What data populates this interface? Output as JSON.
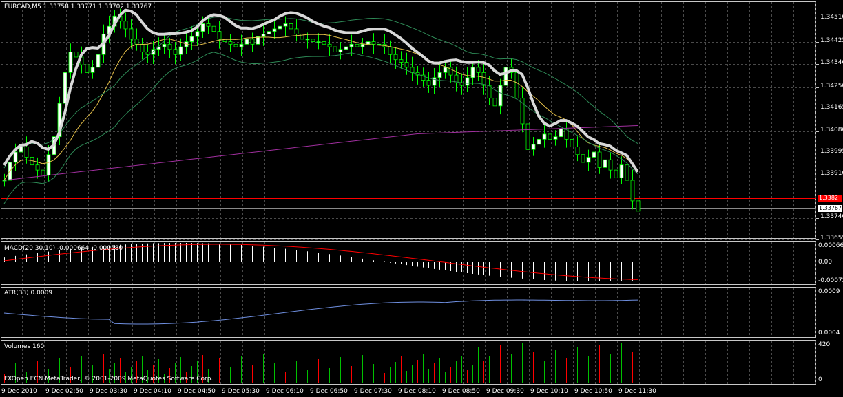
{
  "main": {
    "title": "EURCAD,M5  1.33758 1.33771 1.33702 1.33767",
    "price_levels": [
      "1.34510",
      "1.34425",
      "1.34340",
      "1.34250",
      "1.34165",
      "1.34080",
      "1.33995",
      "1.33910",
      "1.33825",
      "1.33740",
      "1.33655"
    ],
    "current_price": "1.33767",
    "line_price": "1.3382",
    "colors": {
      "background": "#000000",
      "grid": "#4a4a4a",
      "up_candle": "#ffffff",
      "down_candle": "#000000",
      "outline": "#00ff00",
      "ma_fast": "#e8c24a",
      "ma_slow": "#a02f9e",
      "bands": "#2e8b57",
      "envelope": "#d8d8d8",
      "hline": "#ff0000"
    }
  },
  "macd": {
    "title": "MACD(20,30,10) -0.000664 -0.000580",
    "levels": [
      "0.00066",
      "0.00",
      "-0.00072"
    ]
  },
  "atr": {
    "title": "ATR(33) 0.0009",
    "levels": [
      "0.0009",
      "0.0004"
    ]
  },
  "volumes": {
    "title": "Volumes 160",
    "levels": [
      "420",
      "0"
    ]
  },
  "copyright": "FXOpen ECN MetaTrader, © 2001-2009 MetaQuotes Software Corp.",
  "time_labels": [
    "9 Dec 2010",
    "9 Dec 02:50",
    "9 Dec 03:30",
    "9 Dec 04:10",
    "9 Dec 04:50",
    "9 Dec 05:30",
    "9 Dec 06:10",
    "9 Dec 06:50",
    "9 Dec 07:30",
    "9 Dec 08:10",
    "9 Dec 08:50",
    "9 Dec 09:30",
    "9 Dec 10:10",
    "9 Dec 10:50",
    "9 Dec 11:30"
  ]
}
